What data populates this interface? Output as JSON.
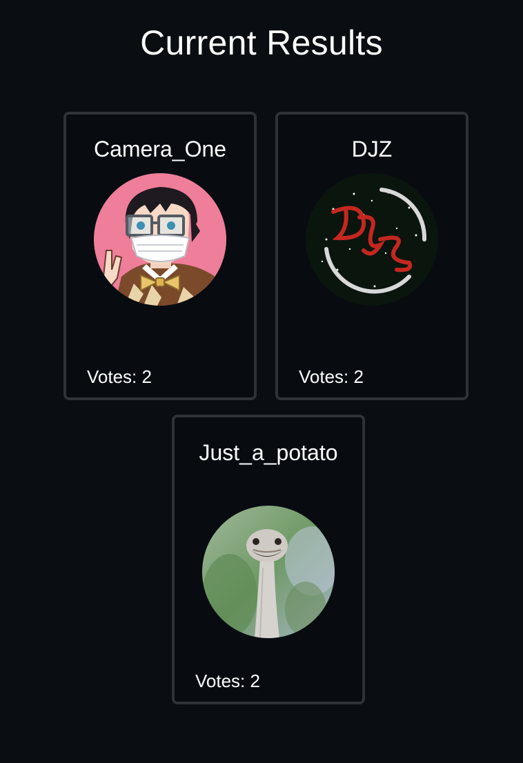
{
  "page": {
    "title": "Current Results"
  },
  "results": [
    {
      "name": "Camera_One",
      "votes_label": "Votes:",
      "votes": "2",
      "avatar_icon": "anime-masked-character-avatar",
      "avatar_bg": "#ee7e9a"
    },
    {
      "name": "DJZ",
      "votes_label": "Votes:",
      "votes": "2",
      "avatar_icon": "djz-logo-avatar",
      "avatar_bg": "#0a150e"
    },
    {
      "name": "Just_a_potato",
      "votes_label": "Votes:",
      "votes": "2",
      "avatar_icon": "ostrich-photo-avatar",
      "avatar_bg": "#7da27a"
    }
  ],
  "colors": {
    "background": "#0a0e13",
    "card_border": "#2f3237",
    "text": "#ffffff"
  }
}
